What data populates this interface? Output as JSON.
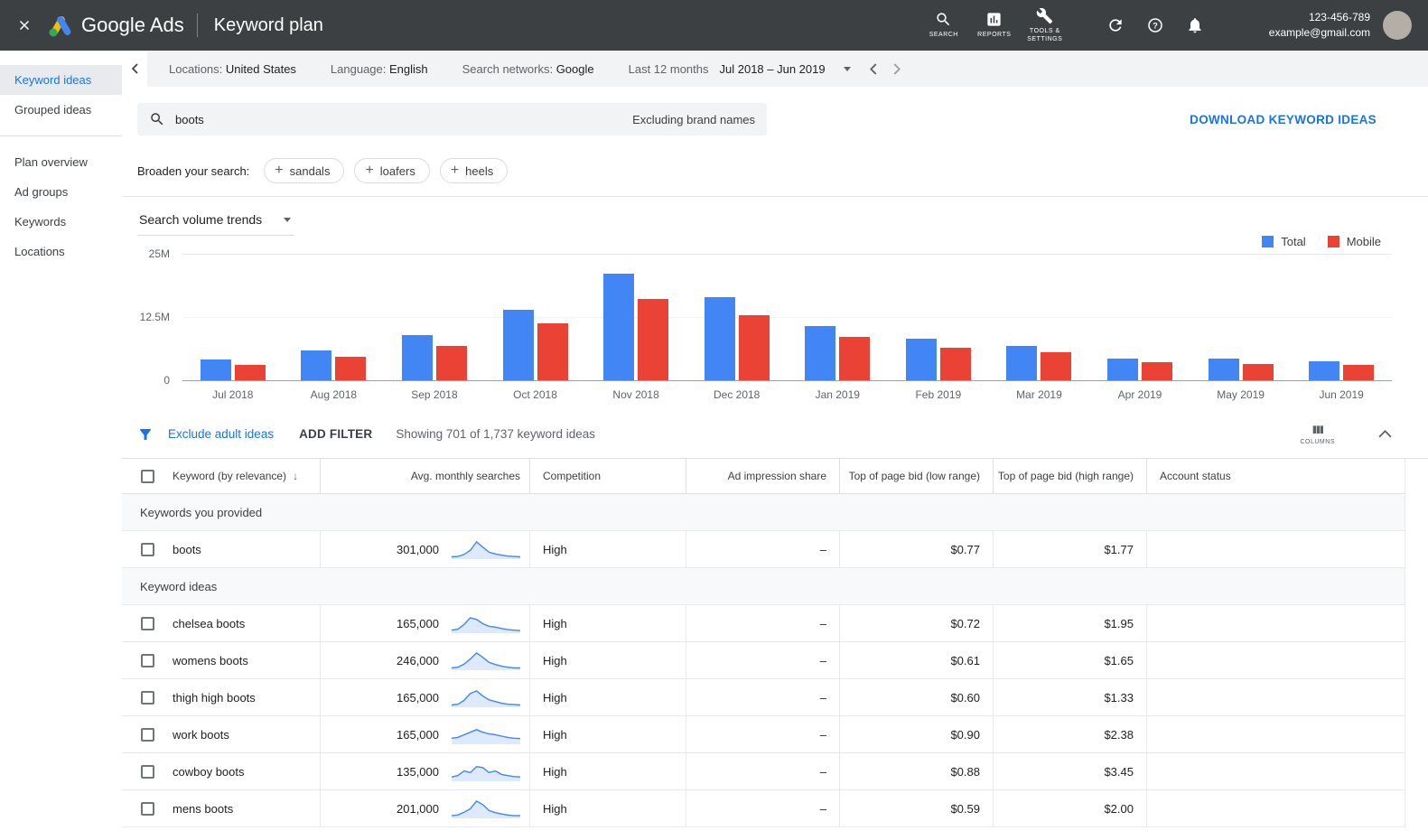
{
  "topbar": {
    "product_name": "Google Ads",
    "page_title": "Keyword plan",
    "icons": {
      "search_label": "SEARCH",
      "reports_label": "REPORTS",
      "tools_label": "TOOLS & SETTINGS"
    },
    "account_id": "123-456-789",
    "account_email": "example@gmail.com"
  },
  "sidebar": {
    "items": [
      {
        "label": "Keyword ideas",
        "active": true
      },
      {
        "label": "Grouped ideas",
        "active": false
      },
      {
        "label": "Plan overview",
        "active": false
      },
      {
        "label": "Ad groups",
        "active": false
      },
      {
        "label": "Keywords",
        "active": false
      },
      {
        "label": "Locations",
        "active": false
      }
    ],
    "divider_after": 1
  },
  "settings_bar": {
    "items": [
      {
        "label": "Locations:",
        "value": "United States"
      },
      {
        "label": "Language:",
        "value": "English"
      },
      {
        "label": "Search networks:",
        "value": "Google"
      }
    ],
    "date_range_label": "Last 12 months",
    "date_range_value": "Jul 2018 – Jun 2019"
  },
  "search_bar": {
    "query": "boots",
    "excluding_note": "Excluding brand names",
    "download_link": "DOWNLOAD KEYWORD IDEAS"
  },
  "broaden_search": {
    "label": "Broaden your search:",
    "chips": [
      "sandals",
      "loafers",
      "heels"
    ]
  },
  "chart_data": {
    "type": "bar",
    "title": "Search volume trends",
    "categories": [
      "Jul 2018",
      "Aug 2018",
      "Sep 2018",
      "Oct 2018",
      "Nov 2018",
      "Dec 2018",
      "Jan 2019",
      "Feb 2019",
      "Mar 2019",
      "Apr 2019",
      "May 2019",
      "Jun 2019"
    ],
    "series": [
      {
        "name": "Total",
        "color": "#4285f4",
        "values": [
          4100000,
          5900000,
          9000000,
          14000000,
          21000000,
          16500000,
          10800000,
          8300000,
          6800000,
          4300000,
          4300000,
          3800000
        ]
      },
      {
        "name": "Mobile",
        "color": "#ea4335",
        "values": [
          3100000,
          4700000,
          6800000,
          11200000,
          16000000,
          12800000,
          8500000,
          6500000,
          5600000,
          3600000,
          3200000,
          3100000
        ]
      }
    ],
    "ylim": [
      0,
      25000000
    ],
    "yticks": [
      {
        "value": 25000000,
        "label": "25M"
      },
      {
        "value": 12500000,
        "label": "12.5M"
      },
      {
        "value": 0,
        "label": "0"
      }
    ],
    "legend_position": "top-right",
    "grid": true
  },
  "results_toolbar": {
    "exclude_adult_label": "Exclude adult ideas",
    "add_filter_label": "ADD FILTER",
    "showing_text": "Showing 701 of 1,737 keyword ideas",
    "columns_label": "COLUMNS"
  },
  "table": {
    "headers": [
      {
        "label": "Keyword (by relevance)",
        "sorted": true
      },
      {
        "label": "Avg. monthly searches",
        "sorted": false
      },
      {
        "label": "Competition",
        "sorted": false
      },
      {
        "label": "Ad impression share",
        "sorted": false
      },
      {
        "label": "Top of page bid (low range)",
        "sorted": false
      },
      {
        "label": "Top of page bid (high range)",
        "sorted": false
      },
      {
        "label": "Account status",
        "sorted": false
      }
    ],
    "sections": [
      {
        "label": "Keywords you provided",
        "rows": [
          {
            "keyword": "boots",
            "avg_monthly_searches": "301,000",
            "trend": [
              0.08,
              0.1,
              0.22,
              0.45,
              0.95,
              0.65,
              0.35,
              0.25,
              0.18,
              0.12,
              0.1,
              0.08
            ],
            "competition": "High",
            "ad_impression_share": "–",
            "bid_low": "$0.77",
            "bid_high": "$1.77",
            "account_status": ""
          }
        ]
      },
      {
        "label": "Keyword ideas",
        "rows": [
          {
            "keyword": "chelsea boots",
            "avg_monthly_searches": "165,000",
            "trend": [
              0.12,
              0.18,
              0.45,
              0.85,
              0.75,
              0.5,
              0.35,
              0.3,
              0.22,
              0.15,
              0.12,
              0.1
            ],
            "competition": "High",
            "ad_impression_share": "–",
            "bid_low": "$0.72",
            "bid_high": "$1.95",
            "account_status": ""
          },
          {
            "keyword": "womens boots",
            "avg_monthly_searches": "246,000",
            "trend": [
              0.08,
              0.12,
              0.3,
              0.6,
              0.95,
              0.7,
              0.4,
              0.28,
              0.18,
              0.12,
              0.08,
              0.08
            ],
            "competition": "High",
            "ad_impression_share": "–",
            "bid_low": "$0.61",
            "bid_high": "$1.65",
            "account_status": ""
          },
          {
            "keyword": "thigh high boots",
            "avg_monthly_searches": "165,000",
            "trend": [
              0.08,
              0.12,
              0.35,
              0.75,
              0.9,
              0.6,
              0.38,
              0.28,
              0.18,
              0.12,
              0.1,
              0.08
            ],
            "competition": "High",
            "ad_impression_share": "–",
            "bid_low": "$0.60",
            "bid_high": "$1.33",
            "account_status": ""
          },
          {
            "keyword": "work boots",
            "avg_monthly_searches": "165,000",
            "trend": [
              0.3,
              0.35,
              0.5,
              0.65,
              0.8,
              0.65,
              0.55,
              0.5,
              0.42,
              0.35,
              0.3,
              0.28
            ],
            "competition": "High",
            "ad_impression_share": "–",
            "bid_low": "$0.90",
            "bid_high": "$2.38",
            "account_status": ""
          },
          {
            "keyword": "cowboy boots",
            "avg_monthly_searches": "135,000",
            "trend": [
              0.2,
              0.28,
              0.55,
              0.45,
              0.8,
              0.75,
              0.45,
              0.55,
              0.35,
              0.28,
              0.22,
              0.2
            ],
            "competition": "High",
            "ad_impression_share": "–",
            "bid_low": "$0.88",
            "bid_high": "$3.45",
            "account_status": ""
          },
          {
            "keyword": "mens boots",
            "avg_monthly_searches": "201,000",
            "trend": [
              0.1,
              0.14,
              0.3,
              0.5,
              0.95,
              0.75,
              0.4,
              0.28,
              0.2,
              0.14,
              0.1,
              0.1
            ],
            "competition": "High",
            "ad_impression_share": "–",
            "bid_low": "$0.59",
            "bid_high": "$2.00",
            "account_status": ""
          }
        ]
      }
    ]
  },
  "colors": {
    "accent": "#1a73e8",
    "topbar_bg": "#3c4043",
    "bar_total": "#4285f4",
    "bar_mobile": "#ea4335"
  }
}
